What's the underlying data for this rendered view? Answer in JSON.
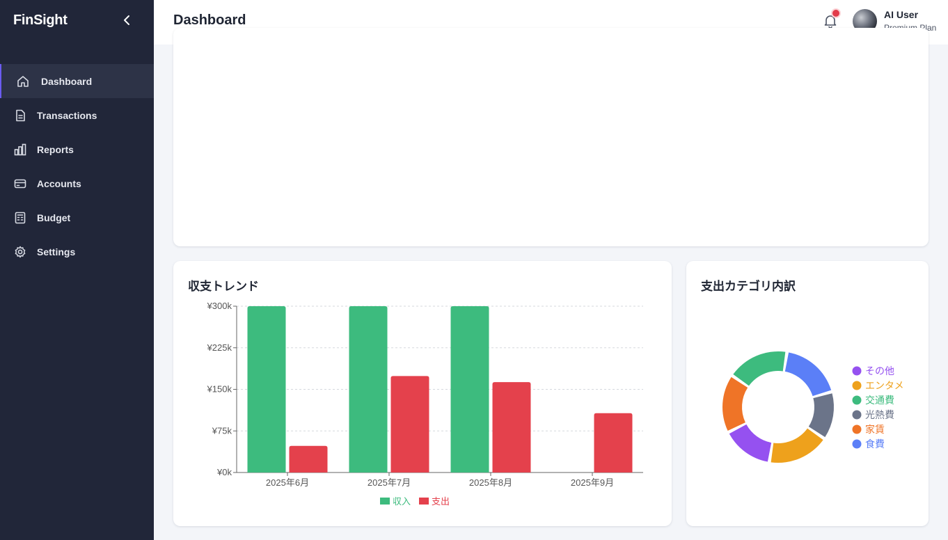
{
  "app": {
    "brand": "FinSight"
  },
  "sidebar": {
    "items": [
      {
        "label": "Dashboard",
        "icon": "home-icon",
        "active": true
      },
      {
        "label": "Transactions",
        "icon": "document-icon",
        "active": false
      },
      {
        "label": "Reports",
        "icon": "bar-chart-icon",
        "active": false
      },
      {
        "label": "Accounts",
        "icon": "credit-card-icon",
        "active": false
      },
      {
        "label": "Budget",
        "icon": "calculator-icon",
        "active": false
      },
      {
        "label": "Settings",
        "icon": "gear-icon",
        "active": false
      }
    ]
  },
  "header": {
    "title": "Dashboard",
    "user": {
      "name": "AI User",
      "plan": "Premium Plan"
    },
    "notification_badge": true
  },
  "colors": {
    "accent": "#6b5cf0",
    "sidebar_bg": "#212639",
    "income": "#3dbb7e",
    "expense": "#e4414c"
  },
  "charts": {
    "trend": {
      "title": "収支トレンド"
    },
    "category": {
      "title": "支出カテゴリ内訳"
    }
  },
  "chart_data": [
    {
      "type": "bar",
      "title": "収支トレンド",
      "categories": [
        "2025年6月",
        "2025年7月",
        "2025年8月",
        "2025年9月"
      ],
      "series": [
        {
          "name": "収入",
          "color": "#3dbb7e",
          "values": [
            300000,
            300000,
            300000,
            0
          ]
        },
        {
          "name": "支出",
          "color": "#e4414c",
          "values": [
            48000,
            174000,
            163000,
            107000
          ]
        }
      ],
      "ylim": [
        0,
        300000
      ],
      "yticks": [
        0,
        75000,
        150000,
        225000,
        300000
      ],
      "ytick_labels": [
        "¥0k",
        "¥75k",
        "¥150k",
        "¥225k",
        "¥300k"
      ],
      "grid": true,
      "legend": "bottom"
    },
    {
      "type": "pie",
      "title": "支出カテゴリ内訳",
      "donut": true,
      "slices": [
        {
          "label": "食費",
          "value": 18,
          "color": "#5b7ff7"
        },
        {
          "label": "光熱費",
          "value": 14,
          "color": "#6b7489"
        },
        {
          "label": "エンタメ",
          "value": 18,
          "color": "#eea11c"
        },
        {
          "label": "その他",
          "value": 15,
          "color": "#9551f0"
        },
        {
          "label": "家賃",
          "value": 17,
          "color": "#ef7427"
        },
        {
          "label": "交通費",
          "value": 18,
          "color": "#3dbb7e"
        }
      ],
      "legend_order": [
        "その他",
        "エンタメ",
        "交通費",
        "光熱費",
        "家賃",
        "食費"
      ],
      "legend": "right"
    }
  ]
}
